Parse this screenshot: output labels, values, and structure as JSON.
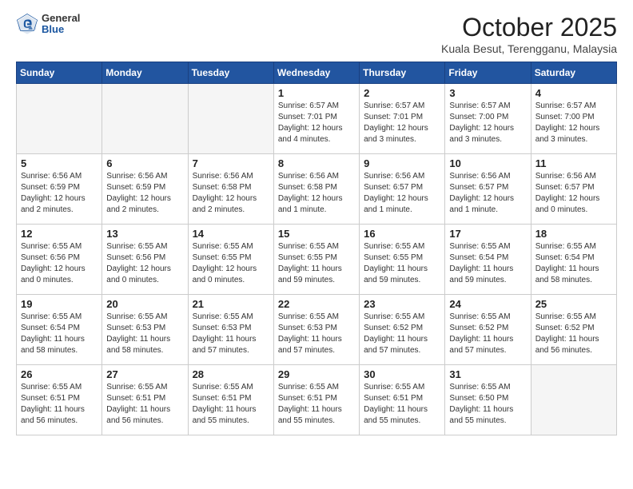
{
  "logo": {
    "general": "General",
    "blue": "Blue"
  },
  "title": "October 2025",
  "location": "Kuala Besut, Terengganu, Malaysia",
  "headers": [
    "Sunday",
    "Monday",
    "Tuesday",
    "Wednesday",
    "Thursday",
    "Friday",
    "Saturday"
  ],
  "weeks": [
    [
      {
        "day": "",
        "info": ""
      },
      {
        "day": "",
        "info": ""
      },
      {
        "day": "",
        "info": ""
      },
      {
        "day": "1",
        "info": "Sunrise: 6:57 AM\nSunset: 7:01 PM\nDaylight: 12 hours\nand 4 minutes."
      },
      {
        "day": "2",
        "info": "Sunrise: 6:57 AM\nSunset: 7:01 PM\nDaylight: 12 hours\nand 3 minutes."
      },
      {
        "day": "3",
        "info": "Sunrise: 6:57 AM\nSunset: 7:00 PM\nDaylight: 12 hours\nand 3 minutes."
      },
      {
        "day": "4",
        "info": "Sunrise: 6:57 AM\nSunset: 7:00 PM\nDaylight: 12 hours\nand 3 minutes."
      }
    ],
    [
      {
        "day": "5",
        "info": "Sunrise: 6:56 AM\nSunset: 6:59 PM\nDaylight: 12 hours\nand 2 minutes."
      },
      {
        "day": "6",
        "info": "Sunrise: 6:56 AM\nSunset: 6:59 PM\nDaylight: 12 hours\nand 2 minutes."
      },
      {
        "day": "7",
        "info": "Sunrise: 6:56 AM\nSunset: 6:58 PM\nDaylight: 12 hours\nand 2 minutes."
      },
      {
        "day": "8",
        "info": "Sunrise: 6:56 AM\nSunset: 6:58 PM\nDaylight: 12 hours\nand 1 minute."
      },
      {
        "day": "9",
        "info": "Sunrise: 6:56 AM\nSunset: 6:57 PM\nDaylight: 12 hours\nand 1 minute."
      },
      {
        "day": "10",
        "info": "Sunrise: 6:56 AM\nSunset: 6:57 PM\nDaylight: 12 hours\nand 1 minute."
      },
      {
        "day": "11",
        "info": "Sunrise: 6:56 AM\nSunset: 6:57 PM\nDaylight: 12 hours\nand 0 minutes."
      }
    ],
    [
      {
        "day": "12",
        "info": "Sunrise: 6:55 AM\nSunset: 6:56 PM\nDaylight: 12 hours\nand 0 minutes."
      },
      {
        "day": "13",
        "info": "Sunrise: 6:55 AM\nSunset: 6:56 PM\nDaylight: 12 hours\nand 0 minutes."
      },
      {
        "day": "14",
        "info": "Sunrise: 6:55 AM\nSunset: 6:55 PM\nDaylight: 12 hours\nand 0 minutes."
      },
      {
        "day": "15",
        "info": "Sunrise: 6:55 AM\nSunset: 6:55 PM\nDaylight: 11 hours\nand 59 minutes."
      },
      {
        "day": "16",
        "info": "Sunrise: 6:55 AM\nSunset: 6:55 PM\nDaylight: 11 hours\nand 59 minutes."
      },
      {
        "day": "17",
        "info": "Sunrise: 6:55 AM\nSunset: 6:54 PM\nDaylight: 11 hours\nand 59 minutes."
      },
      {
        "day": "18",
        "info": "Sunrise: 6:55 AM\nSunset: 6:54 PM\nDaylight: 11 hours\nand 58 minutes."
      }
    ],
    [
      {
        "day": "19",
        "info": "Sunrise: 6:55 AM\nSunset: 6:54 PM\nDaylight: 11 hours\nand 58 minutes."
      },
      {
        "day": "20",
        "info": "Sunrise: 6:55 AM\nSunset: 6:53 PM\nDaylight: 11 hours\nand 58 minutes."
      },
      {
        "day": "21",
        "info": "Sunrise: 6:55 AM\nSunset: 6:53 PM\nDaylight: 11 hours\nand 57 minutes."
      },
      {
        "day": "22",
        "info": "Sunrise: 6:55 AM\nSunset: 6:53 PM\nDaylight: 11 hours\nand 57 minutes."
      },
      {
        "day": "23",
        "info": "Sunrise: 6:55 AM\nSunset: 6:52 PM\nDaylight: 11 hours\nand 57 minutes."
      },
      {
        "day": "24",
        "info": "Sunrise: 6:55 AM\nSunset: 6:52 PM\nDaylight: 11 hours\nand 57 minutes."
      },
      {
        "day": "25",
        "info": "Sunrise: 6:55 AM\nSunset: 6:52 PM\nDaylight: 11 hours\nand 56 minutes."
      }
    ],
    [
      {
        "day": "26",
        "info": "Sunrise: 6:55 AM\nSunset: 6:51 PM\nDaylight: 11 hours\nand 56 minutes."
      },
      {
        "day": "27",
        "info": "Sunrise: 6:55 AM\nSunset: 6:51 PM\nDaylight: 11 hours\nand 56 minutes."
      },
      {
        "day": "28",
        "info": "Sunrise: 6:55 AM\nSunset: 6:51 PM\nDaylight: 11 hours\nand 55 minutes."
      },
      {
        "day": "29",
        "info": "Sunrise: 6:55 AM\nSunset: 6:51 PM\nDaylight: 11 hours\nand 55 minutes."
      },
      {
        "day": "30",
        "info": "Sunrise: 6:55 AM\nSunset: 6:51 PM\nDaylight: 11 hours\nand 55 minutes."
      },
      {
        "day": "31",
        "info": "Sunrise: 6:55 AM\nSunset: 6:50 PM\nDaylight: 11 hours\nand 55 minutes."
      },
      {
        "day": "",
        "info": ""
      }
    ]
  ]
}
